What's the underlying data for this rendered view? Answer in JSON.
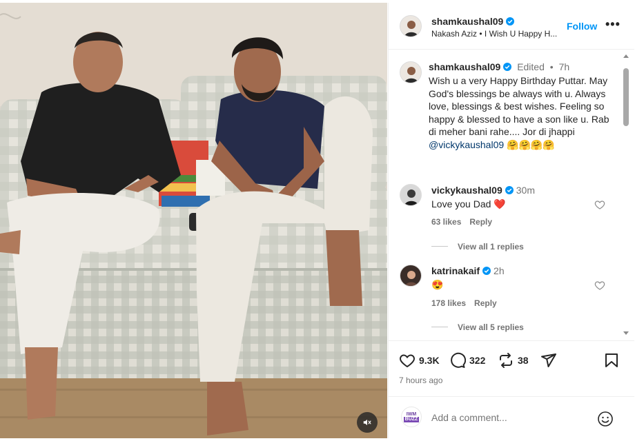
{
  "post": {
    "header": {
      "username": "shamkaushal09",
      "audio": "Nakash Aziz • I Wish U Happy H...",
      "follow_label": "Follow",
      "more_label": "•••"
    },
    "caption": {
      "username": "shamkaushal09",
      "edited": "Edited",
      "dot": "•",
      "time": "7h",
      "text": "Wish u a very Happy Birthday Puttar. May God's blessings be always with u. Always love, blessings & best wishes. Feeling so happy & blessed to have a son like u. Rab di meher bani rahe.... Jor di jhappi ",
      "mention": "@vickykaushal09",
      "emojis": " 🤗🤗🤗🤗"
    },
    "comments": [
      {
        "username": "vickykaushal09",
        "time": "30m",
        "text": "Love you Dad ❤️",
        "likes": "63 likes",
        "reply_label": "Reply",
        "view_replies": "View all 1 replies"
      },
      {
        "username": "katrinakaif",
        "time": "2h",
        "text": "😍",
        "likes": "178 likes",
        "reply_label": "Reply",
        "view_replies": "View all 5 replies"
      }
    ],
    "actions": {
      "likes": "9.3K",
      "comments": "322",
      "reposts": "38"
    },
    "posted_ago": "7 hours ago",
    "comment_box": {
      "placeholder": "Add a comment...",
      "logo_line1": "IWM",
      "logo_line2": "BUZZ"
    },
    "colors": {
      "accent": "#0095f6",
      "verified": "#0095f6",
      "heart_red": "#ed1c24",
      "mention": "#00376b"
    }
  }
}
